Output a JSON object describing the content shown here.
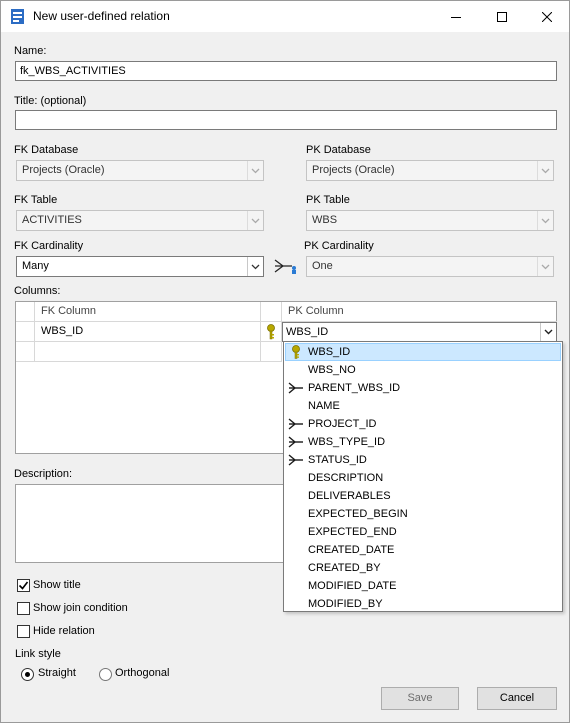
{
  "window": {
    "title": "New user-defined relation"
  },
  "fields": {
    "name_label": "Name:",
    "name_value": "fk_WBS_ACTIVITIES",
    "title_label": "Title: (optional)",
    "title_value": ""
  },
  "fk": {
    "database_label": "FK Database",
    "database_value": "Projects (Oracle)",
    "table_label": "FK Table",
    "table_value": "ACTIVITIES",
    "cardinality_label": "FK Cardinality",
    "cardinality_value": "Many"
  },
  "pk": {
    "database_label": "PK Database",
    "database_value": "Projects (Oracle)",
    "table_label": "PK Table",
    "table_value": "WBS",
    "cardinality_label": "PK Cardinality",
    "cardinality_value": "One"
  },
  "columns": {
    "label": "Columns:",
    "headers": {
      "fk": "FK Column",
      "pk": "PK Column"
    },
    "rows": [
      {
        "fk": "WBS_ID",
        "pk": "WBS_ID"
      }
    ]
  },
  "dropdown": {
    "items": [
      {
        "label": "WBS_ID",
        "icon": "key-icon",
        "selected": true
      },
      {
        "label": "WBS_NO",
        "icon": "",
        "selected": false
      },
      {
        "label": "PARENT_WBS_ID",
        "icon": "relation-icon",
        "selected": false
      },
      {
        "label": "NAME",
        "icon": "",
        "selected": false
      },
      {
        "label": "PROJECT_ID",
        "icon": "relation-icon",
        "selected": false
      },
      {
        "label": "WBS_TYPE_ID",
        "icon": "relation-icon",
        "selected": false
      },
      {
        "label": "STATUS_ID",
        "icon": "relation-icon",
        "selected": false
      },
      {
        "label": "DESCRIPTION",
        "icon": "",
        "selected": false
      },
      {
        "label": "DELIVERABLES",
        "icon": "",
        "selected": false
      },
      {
        "label": "EXPECTED_BEGIN",
        "icon": "",
        "selected": false
      },
      {
        "label": "EXPECTED_END",
        "icon": "",
        "selected": false
      },
      {
        "label": "CREATED_DATE",
        "icon": "",
        "selected": false
      },
      {
        "label": "CREATED_BY",
        "icon": "",
        "selected": false
      },
      {
        "label": "MODIFIED_DATE",
        "icon": "",
        "selected": false
      },
      {
        "label": "MODIFIED_BY",
        "icon": "",
        "selected": false
      }
    ]
  },
  "description": {
    "label": "Description:",
    "value": ""
  },
  "options": {
    "show_title": {
      "label": "Show title",
      "checked": true
    },
    "show_join_condition": {
      "label": "Show join condition",
      "checked": false
    },
    "hide_relation": {
      "label": "Hide relation",
      "checked": false
    }
  },
  "link_style": {
    "label": "Link style",
    "options": [
      "Straight",
      "Orthogonal"
    ],
    "selected": "Straight"
  },
  "buttons": {
    "save": "Save",
    "cancel": "Cancel"
  },
  "colors": {
    "selection": "#cce8ff",
    "selection_border": "#99d1ff",
    "key": "#b8a800",
    "relation": "#1a1a1a"
  }
}
